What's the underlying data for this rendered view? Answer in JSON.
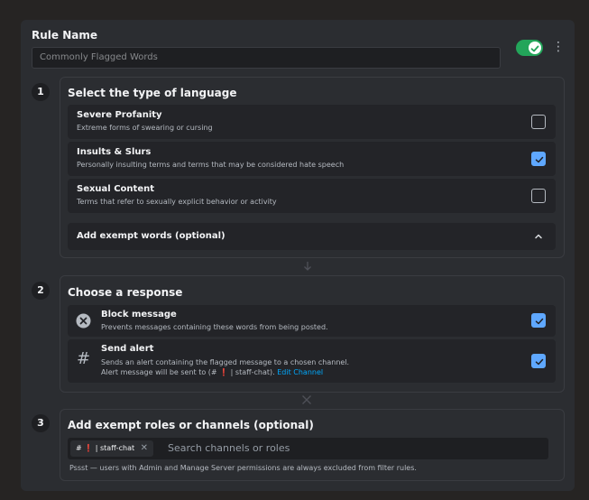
{
  "rule_name": {
    "label": "Rule Name",
    "placeholder": "Commonly Flagged Words",
    "enabled": true
  },
  "step1": {
    "number": "1",
    "title": "Select the type of language",
    "options": [
      {
        "title": "Severe Profanity",
        "desc": "Extreme forms of swearing or cursing",
        "checked": false
      },
      {
        "title": "Insults & Slurs",
        "desc": "Personally insulting terms and terms that may be considered hate speech",
        "checked": true
      },
      {
        "title": "Sexual Content",
        "desc": "Terms that refer to sexually explicit behavior or activity",
        "checked": false
      }
    ],
    "exempt_words_label": "Add exempt words (optional)"
  },
  "step2": {
    "number": "2",
    "title": "Choose a response",
    "block": {
      "title": "Block message",
      "desc": "Prevents messages containing these words from being posted.",
      "checked": true
    },
    "alert": {
      "title": "Send alert",
      "desc": "Sends an alert containing the flagged message to a chosen channel.",
      "desc2": "Alert message will be sent to (# ❗ | staff-chat).",
      "link": "Edit Channel",
      "checked": true
    }
  },
  "step3": {
    "number": "3",
    "title": "Add exempt roles or channels (optional)",
    "tag": "# ❗ | staff-chat",
    "search_placeholder": "Search channels or roles",
    "note": "Pssst — users with Admin and Manage Server permissions are always excluded from filter rules."
  },
  "colors": {
    "accent": "#5fa8ff",
    "toggle_on": "#23a55a",
    "link": "#00a8fc"
  }
}
